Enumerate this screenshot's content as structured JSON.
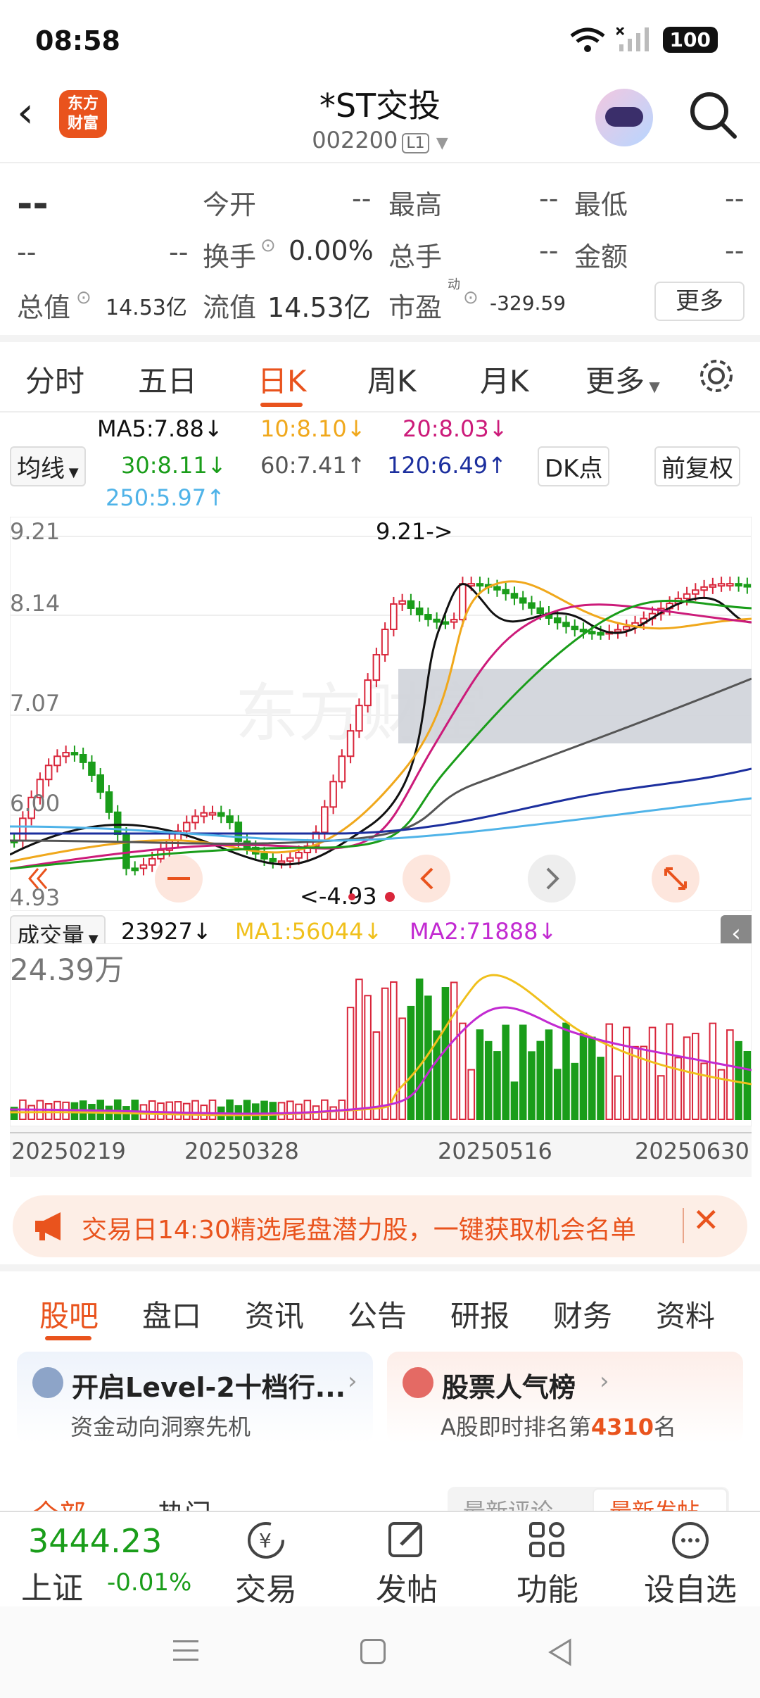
{
  "status": {
    "time": "08:58",
    "battery": "100"
  },
  "header": {
    "title": "*ST交投",
    "code": "002200",
    "level": "L1",
    "logo_line1": "东方",
    "logo_line2": "财富"
  },
  "quote": {
    "price": "--",
    "change": "--",
    "pct": "--",
    "open_label": "今开",
    "open": "--",
    "high_label": "最高",
    "high": "--",
    "low_label": "最低",
    "low": "--",
    "turnover_label": "换手",
    "turnover": "0.00%",
    "volume_label": "总手",
    "volume": "--",
    "amount_label": "金额",
    "amount": "--",
    "mktcap_label": "总值",
    "mktcap": "14.53亿",
    "float_label": "流值",
    "float_value": "14.53亿",
    "pe_label": "市盈",
    "pe_sup": "动",
    "pe": "-329.59",
    "more": "更多"
  },
  "tabs": [
    "分时",
    "五日",
    "日K",
    "周K",
    "月K",
    "更多"
  ],
  "ma_panel": {
    "btn": "均线",
    "dk": "DK点",
    "adjust": "前复权",
    "ma5": "MA5:7.88↓",
    "ma10": "10:8.10↓",
    "ma20": "20:8.03↓",
    "ma30": "30:8.11↓",
    "ma60": "60:7.41↑",
    "ma120": "120:6.49↑",
    "ma250": "250:5.97↑"
  },
  "colors": {
    "up": "#d9263b",
    "down": "#1a9d1a",
    "accent": "#e9531d"
  },
  "chart_data": {
    "type": "candlestick",
    "y_ticks": [
      "9.21",
      "8.14",
      "7.07",
      "6.00",
      "4.93"
    ],
    "max_label": "9.21->",
    "min_label": "<-4.93",
    "watermark": "东方财富"
  },
  "volume": {
    "btn": "成交量",
    "value": "23927↓",
    "ma1": "MA1:56044↓",
    "ma2": "MA2:71888↓",
    "ymax": "24.39万"
  },
  "dates": [
    "20250219",
    "20250328",
    "20250516",
    "20250630"
  ],
  "banner": {
    "text": "交易日14:30精选尾盘潜力股，一键获取机会名单"
  },
  "subtabs": [
    "股吧",
    "盘口",
    "资讯",
    "公告",
    "研报",
    "财务",
    "资料"
  ],
  "cards": [
    {
      "title": "开启Level-2十档行...",
      "desc": "资金动向洞察先机"
    },
    {
      "title": "股票人气榜",
      "desc_prefix": "A股即时排名第",
      "rank": "4310",
      "desc_suffix": "名"
    }
  ],
  "feed": {
    "tab1": "全部",
    "tab2": "热门",
    "sort1": "最新评论",
    "sort2": "最新发帖"
  },
  "bottom": {
    "index_value": "3444.23",
    "index_name": "上证",
    "index_pct": "-0.01%",
    "trade": "交易",
    "post": "发帖",
    "func": "功能",
    "watch": "设自选"
  }
}
